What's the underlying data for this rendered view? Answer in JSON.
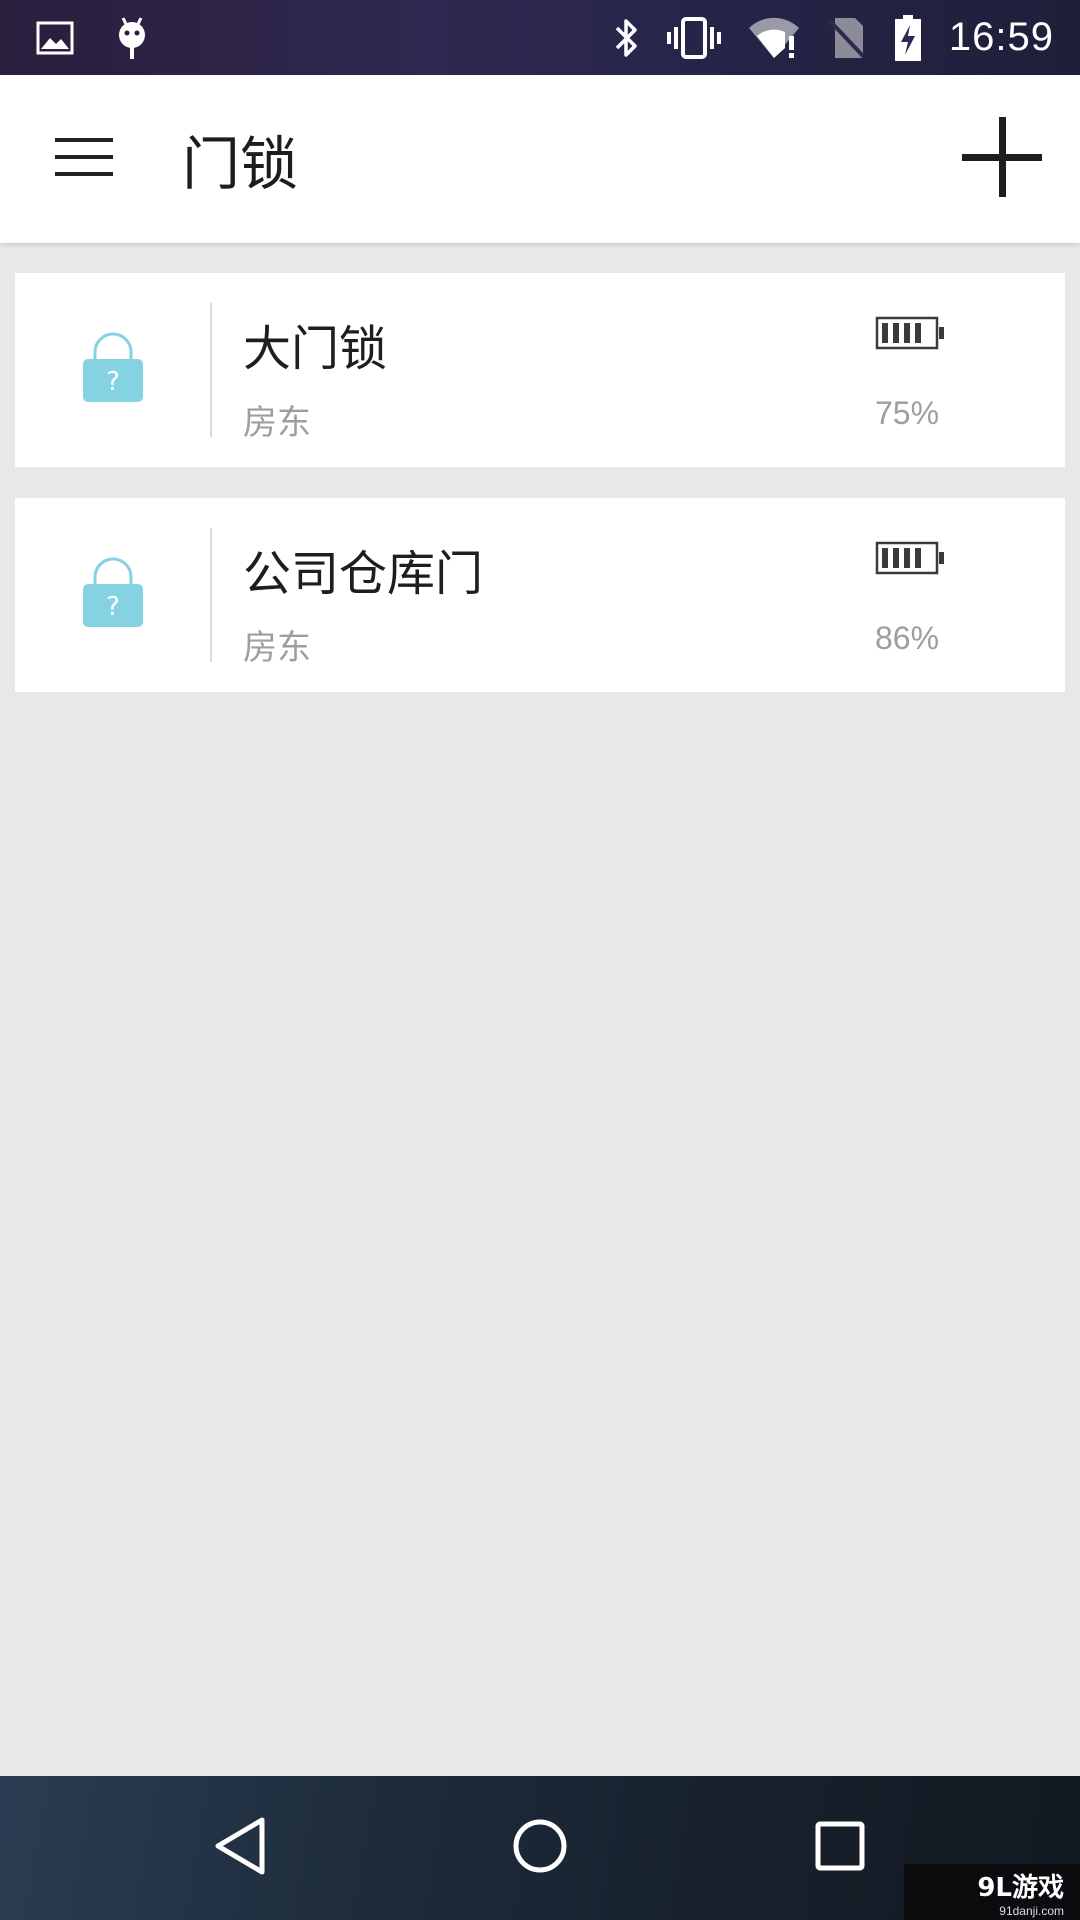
{
  "status_bar": {
    "time": "16:59",
    "left_icons": [
      "image-icon",
      "android-icon"
    ],
    "right_icons": [
      "bluetooth-icon",
      "vibrate-icon",
      "wifi-alert-icon",
      "no-sim-icon",
      "battery-charging-icon"
    ]
  },
  "app_bar": {
    "title": "门锁",
    "menu_icon": "menu-icon",
    "add_icon": "add-icon"
  },
  "locks": [
    {
      "name": "大门锁",
      "role": "房东",
      "battery": "75%",
      "battery_level": 0.75,
      "status_icon": "lock-unknown-icon"
    },
    {
      "name": "公司仓库门",
      "role": "房东",
      "battery": "86%",
      "battery_level": 0.86,
      "status_icon": "lock-unknown-icon"
    }
  ],
  "nav_bar": {
    "back_icon": "back-icon",
    "home_icon": "home-icon",
    "recents_icon": "recents-icon"
  },
  "watermark": {
    "main": "9L游戏",
    "sub": "91danji.com"
  },
  "colors": {
    "lock_icon": "#85d2e3",
    "text_primary": "#1e1e1e",
    "text_secondary": "#9e9e9e",
    "background": "#e8e8e8"
  }
}
